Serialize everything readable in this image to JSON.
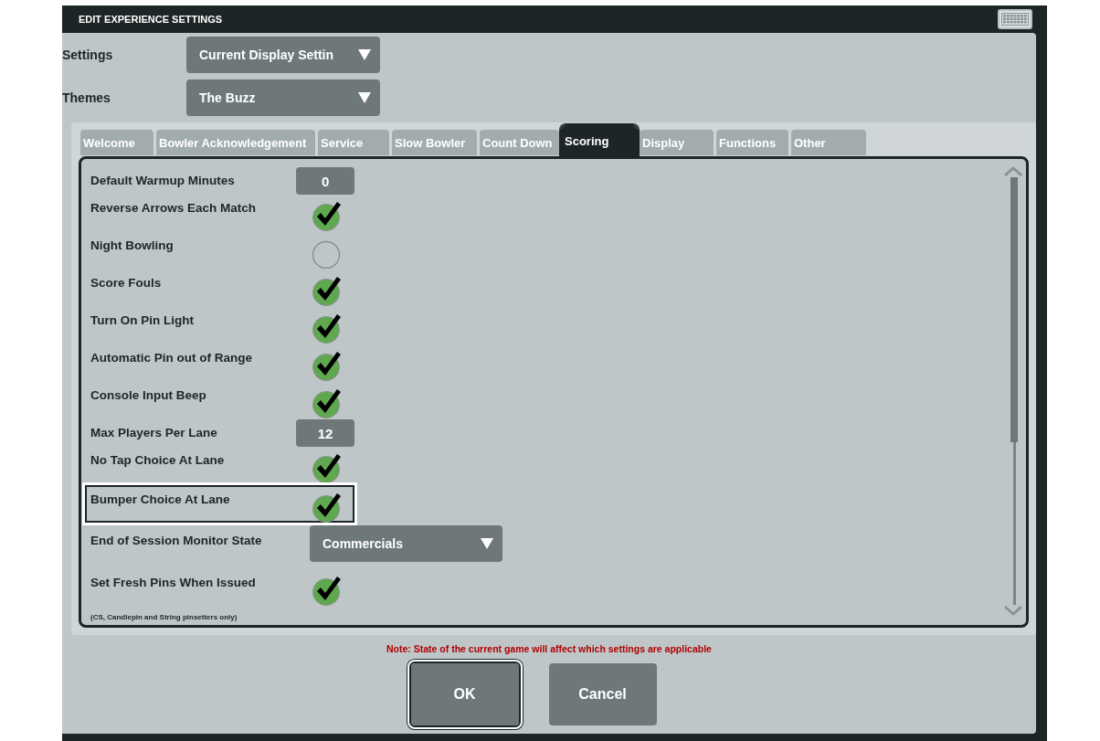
{
  "window": {
    "title": "EDIT EXPERIENCE SETTINGS"
  },
  "selectors": [
    {
      "label": "Settings",
      "value": "Current Display Settin"
    },
    {
      "label": "Themes",
      "value": "The Buzz"
    }
  ],
  "tabs": [
    {
      "label": "Welcome",
      "selected": false
    },
    {
      "label": "Bowler Acknowledgement",
      "selected": false
    },
    {
      "label": "Service",
      "selected": false
    },
    {
      "label": "Slow Bowler",
      "selected": false
    },
    {
      "label": "Count Down",
      "selected": false
    },
    {
      "label": "Scoring",
      "selected": true
    },
    {
      "label": "Display",
      "selected": false
    },
    {
      "label": "Functions",
      "selected": false
    },
    {
      "label": "Other",
      "selected": false
    }
  ],
  "settings": [
    {
      "kind": "number",
      "label": "Default Warmup Minutes",
      "value": "0",
      "focused": false
    },
    {
      "kind": "check",
      "label": "Reverse Arrows Each Match",
      "checked": true,
      "focused": false
    },
    {
      "kind": "check",
      "label": "Night Bowling",
      "checked": false,
      "focused": false
    },
    {
      "kind": "check",
      "label": "Score Fouls",
      "checked": true,
      "focused": false
    },
    {
      "kind": "check",
      "label": "Turn On Pin Light",
      "checked": true,
      "focused": false
    },
    {
      "kind": "check",
      "label": "Automatic Pin out of Range",
      "checked": true,
      "focused": false
    },
    {
      "kind": "check",
      "label": "Console Input Beep",
      "checked": true,
      "focused": false
    },
    {
      "kind": "number",
      "label": "Max Players Per Lane",
      "value": "12",
      "focused": false
    },
    {
      "kind": "check",
      "label": "No Tap Choice At Lane",
      "checked": true,
      "focused": false
    },
    {
      "kind": "check",
      "label": "Bumper Choice At Lane",
      "checked": true,
      "focused": true
    },
    {
      "kind": "select",
      "label": "End of Session Monitor State",
      "value": "Commercials",
      "focused": false
    },
    {
      "kind": "check",
      "label": "Set Fresh Pins When Issued",
      "checked": true,
      "focused": false,
      "note": "(CS, Candlepin and String pinsetters only)"
    }
  ],
  "note": "Note: State of the current game will affect which settings are applicable",
  "buttons": [
    {
      "label": "OK",
      "focused": true
    },
    {
      "label": "Cancel",
      "focused": false
    }
  ]
}
